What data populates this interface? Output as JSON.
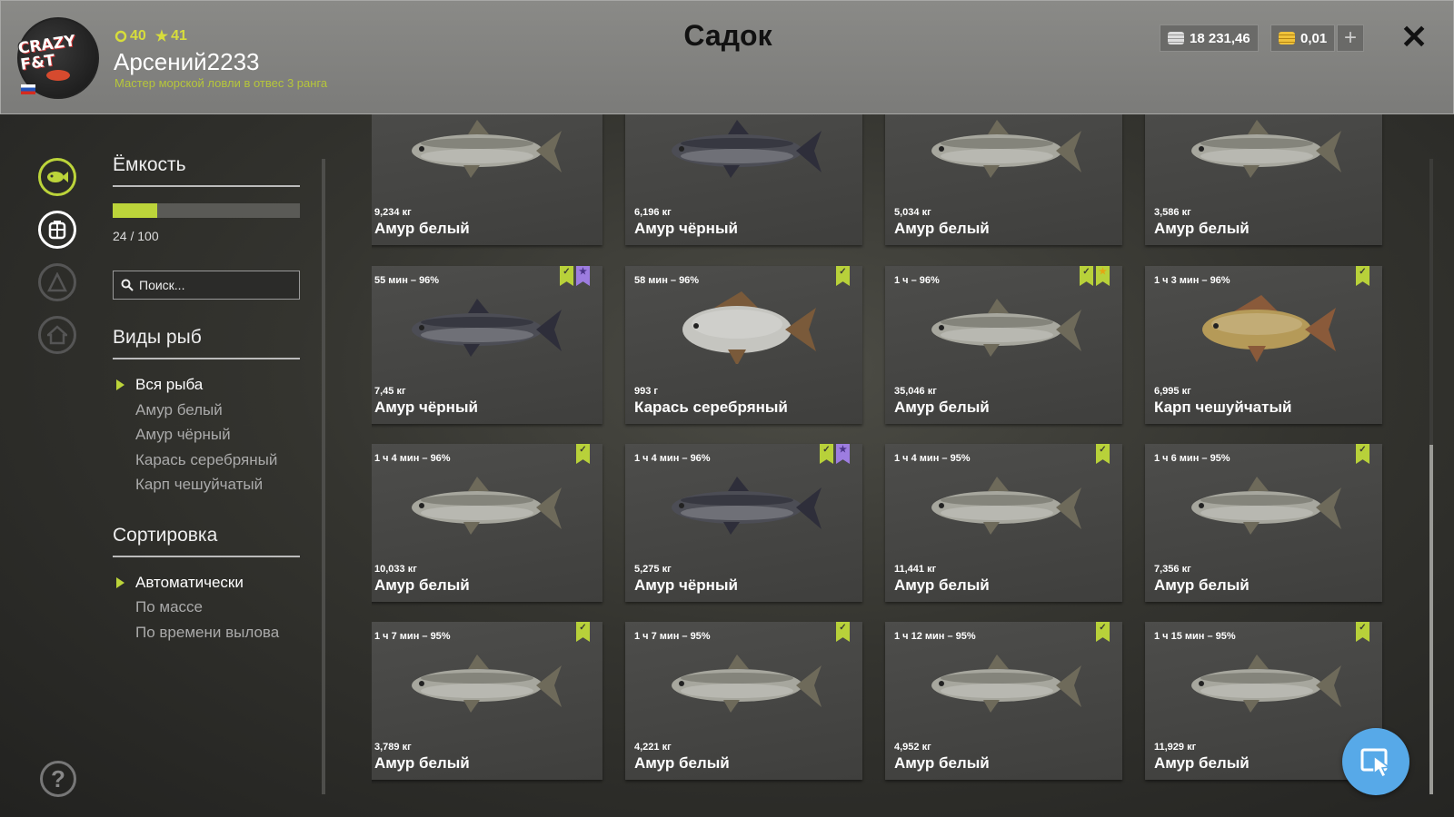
{
  "header": {
    "title": "Садок",
    "player": {
      "name": "Арсений2233",
      "subtitle": "Мастер морской ловли в отвес 3 ранга",
      "level": "40",
      "rank": "41",
      "avatar_text": "CRAZY F&T"
    },
    "currency": {
      "silver": "18 231,46",
      "gold": "0,01"
    }
  },
  "sidebar_icons": [
    "fish-icon",
    "keepnet-icon",
    "boat-icon",
    "home-icon"
  ],
  "panel": {
    "capacity": {
      "title": "Ёмкость",
      "current": 24,
      "max": 100,
      "text": "24 / 100",
      "fraction": 0.24
    },
    "search": {
      "placeholder": "Поиск..."
    },
    "species": {
      "title": "Виды рыб",
      "items": [
        {
          "label": "Вся рыба",
          "active": true
        },
        {
          "label": "Амур белый",
          "active": false
        },
        {
          "label": "Амур чёрный",
          "active": false
        },
        {
          "label": "Карась серебряный",
          "active": false
        },
        {
          "label": "Карп чешуйчатый",
          "active": false
        }
      ]
    },
    "sort": {
      "title": "Сортировка",
      "items": [
        {
          "label": "Автоматически",
          "active": true
        },
        {
          "label": "По массе",
          "active": false
        },
        {
          "label": "По времени вылова",
          "active": false
        }
      ]
    }
  },
  "fish": [
    {
      "time": "",
      "weight": "9,234 кг",
      "name": "Амур белый",
      "kind": "white",
      "badges": []
    },
    {
      "time": "",
      "weight": "6,196 кг",
      "name": "Амур чёрный",
      "kind": "black",
      "badges": []
    },
    {
      "time": "",
      "weight": "5,034 кг",
      "name": "Амур белый",
      "kind": "white",
      "badges": []
    },
    {
      "time": "",
      "weight": "3,586 кг",
      "name": "Амур белый",
      "kind": "white",
      "badges": []
    },
    {
      "time": "55 мин – 96%",
      "weight": "7,45 кг",
      "name": "Амур чёрный",
      "kind": "black",
      "badges": [
        "green",
        "purple"
      ]
    },
    {
      "time": "58 мин – 96%",
      "weight": "993 г",
      "name": "Карась серебряный",
      "kind": "crucian",
      "badges": [
        "green"
      ]
    },
    {
      "time": "1 ч – 96%",
      "weight": "35,046 кг",
      "name": "Амур белый",
      "kind": "white",
      "badges": [
        "green",
        "yellow"
      ]
    },
    {
      "time": "1 ч 3 мин – 96%",
      "weight": "6,995 кг",
      "name": "Карп чешуйчатый",
      "kind": "carp",
      "badges": [
        "green"
      ]
    },
    {
      "time": "1 ч 4 мин – 96%",
      "weight": "10,033 кг",
      "name": "Амур белый",
      "kind": "white",
      "badges": [
        "green"
      ]
    },
    {
      "time": "1 ч 4 мин – 96%",
      "weight": "5,275 кг",
      "name": "Амур чёрный",
      "kind": "black",
      "badges": [
        "green",
        "purple"
      ]
    },
    {
      "time": "1 ч 4 мин – 95%",
      "weight": "11,441 кг",
      "name": "Амур белый",
      "kind": "white",
      "badges": [
        "green"
      ]
    },
    {
      "time": "1 ч 6 мин – 95%",
      "weight": "7,356 кг",
      "name": "Амур белый",
      "kind": "white",
      "badges": [
        "green"
      ]
    },
    {
      "time": "1 ч 7 мин – 95%",
      "weight": "3,789 кг",
      "name": "Амур белый",
      "kind": "white",
      "badges": [
        "green"
      ]
    },
    {
      "time": "1 ч 7 мин – 95%",
      "weight": "4,221 кг",
      "name": "Амур белый",
      "kind": "white",
      "badges": [
        "green"
      ]
    },
    {
      "time": "1 ч 12 мин – 95%",
      "weight": "4,952 кг",
      "name": "Амур белый",
      "kind": "white",
      "badges": [
        "green"
      ]
    },
    {
      "time": "1 ч 15 мин – 95%",
      "weight": "11,929 кг",
      "name": "Амур белый",
      "kind": "white",
      "badges": [
        "green"
      ]
    }
  ],
  "scroll": {
    "position": 0.45,
    "visible_fraction": 0.55
  },
  "colors": {
    "accent": "#bcd43a",
    "fab": "#57a9e8",
    "white_amur": "#a7a79e",
    "black_amur": "#4c4d55",
    "crucian": "#c5c5c0",
    "carp": "#b59a58"
  }
}
